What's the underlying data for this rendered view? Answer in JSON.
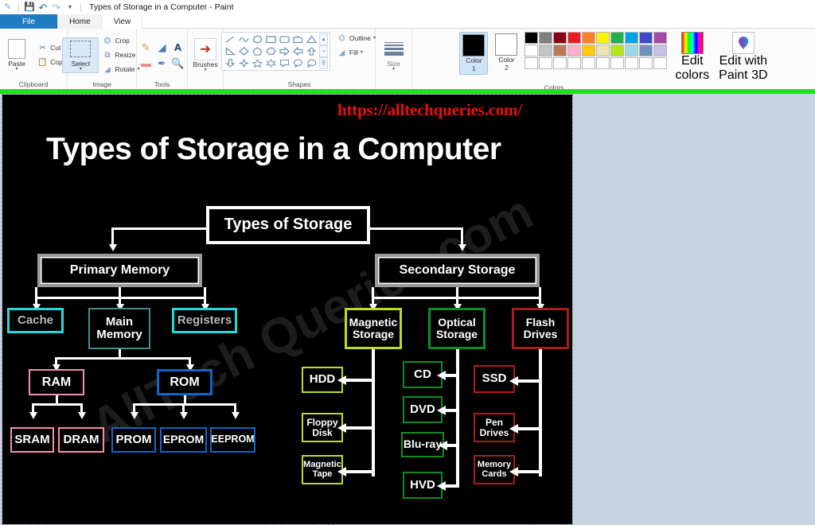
{
  "window": {
    "title": "Types of Storage in a Computer - Paint",
    "quick_access": [
      "paint-icon",
      "save-icon",
      "undo-icon",
      "redo-icon",
      "customize-icon"
    ]
  },
  "tabs": [
    {
      "label": "File",
      "state": "file"
    },
    {
      "label": "Home",
      "state": "active"
    },
    {
      "label": "View",
      "state": "normal"
    }
  ],
  "ribbon": {
    "groups": [
      {
        "name": "Clipboard",
        "label": "Clipboard",
        "big": {
          "label": "Paste",
          "icon": "paste-icon",
          "caret": "▾"
        },
        "small": [
          {
            "label": "Cut",
            "icon": "scissors-icon",
            "glyph": "✂"
          },
          {
            "label": "Copy",
            "icon": "copy-icon",
            "glyph": "❐"
          }
        ]
      },
      {
        "name": "Image",
        "label": "Image",
        "big": {
          "label": "Select",
          "icon": "select-icon",
          "caret": "▾"
        },
        "small": [
          {
            "label": "Crop",
            "icon": "crop-icon",
            "glyph": "⌧"
          },
          {
            "label": "Resize",
            "icon": "resize-icon",
            "glyph": "⧉"
          },
          {
            "label": "Rotate",
            "icon": "rotate-icon",
            "glyph": "◢",
            "caret": "▾"
          }
        ]
      },
      {
        "name": "Tools",
        "label": "Tools",
        "tools": [
          {
            "icon": "pencil-icon",
            "glyph": "✎"
          },
          {
            "icon": "fill-bucket-icon",
            "glyph": "◤"
          },
          {
            "icon": "text-icon",
            "glyph": "A"
          },
          {
            "icon": "eraser-icon",
            "glyph": "▬"
          },
          {
            "icon": "color-picker-icon",
            "glyph": "✒"
          },
          {
            "icon": "magnifier-icon",
            "glyph": "⚲"
          }
        ]
      },
      {
        "name": "Brushes",
        "label": "",
        "big": {
          "label": "Brushes",
          "icon": "brush-icon",
          "caret": "▾"
        }
      },
      {
        "name": "Shapes",
        "label": "Shapes",
        "outline": {
          "label": "Outline",
          "icon": "outline-icon",
          "caret": "▾"
        },
        "fill": {
          "label": "Fill",
          "icon": "fill-icon",
          "caret": "▾"
        },
        "scroll": [
          "▲",
          "▪",
          "☰"
        ]
      },
      {
        "name": "Size",
        "label": "",
        "big": {
          "label": "Size",
          "icon": "size-icon",
          "caret": "▾"
        }
      },
      {
        "name": "Colors",
        "label": "Colors",
        "color1": {
          "label_line1": "Color",
          "label_line2": "1",
          "value": "#000000"
        },
        "color2": {
          "label_line1": "Color",
          "label_line2": "2",
          "value": "#ffffff"
        },
        "edit_colors": {
          "label_line1": "Edit",
          "label_line2": "colors",
          "icon": "rainbow-icon"
        },
        "paint3d": {
          "label_line1": "Edit with",
          "label_line2": "Paint 3D",
          "icon": "paint3d-icon"
        },
        "palette_row1": [
          "#000000",
          "#7f7f7f",
          "#880015",
          "#ed1c24",
          "#ff7f27",
          "#fff200",
          "#22b14c",
          "#00a2e8",
          "#3f48cc",
          "#a349a4"
        ],
        "palette_row2": [
          "#ffffff",
          "#c3c3c3",
          "#b97a57",
          "#ffaec9",
          "#ffc90e",
          "#efe4b0",
          "#b5e61d",
          "#99d9ea",
          "#7092be",
          "#c8bfe7"
        ],
        "palette_row3": [
          "#ffffff",
          "#ffffff",
          "#ffffff",
          "#ffffff",
          "#ffffff",
          "#ffffff",
          "#ffffff",
          "#ffffff",
          "#ffffff",
          "#ffffff"
        ]
      }
    ]
  },
  "canvas": {
    "background": "#000000",
    "url_watermark": "https://alltechqueries.com/",
    "url_color": "#e8100f",
    "diagram_title": "Types of Storage in a Computer",
    "site_watermark": "AllTech Queries.com",
    "nodes": {
      "root": "Types of Storage",
      "primary": "Primary Memory",
      "secondary": "Secondary Storage",
      "cache": "Cache",
      "main_memory_l1": "Main",
      "main_memory_l2": "Memory",
      "registers": "Registers",
      "ram": "RAM",
      "rom": "ROM",
      "sram": "SRAM",
      "dram": "DRAM",
      "prom": "PROM",
      "eprom": "EPROM",
      "eeprom": "EEPROM",
      "magnetic_l1": "Magnetic",
      "magnetic_l2": "Storage",
      "optical_l1": "Optical",
      "optical_l2": "Storage",
      "flash_l1": "Flash",
      "flash_l2": "Drives",
      "hdd": "HDD",
      "floppy_l1": "Floppy",
      "floppy_l2": "Disk",
      "magtape_l1": "Magnetic",
      "magtape_l2": "Tape",
      "cd": "CD",
      "dvd": "DVD",
      "bluray": "Blu-ray",
      "hvd": "HVD",
      "ssd": "SSD",
      "pen_l1": "Pen",
      "pen_l2": "Drives",
      "memcard_l1": "Memory",
      "memcard_l2": "Cards"
    },
    "colors": {
      "white": "#ffffff",
      "gray_frame": "#9a9a9a",
      "cyan": "#28d7d7",
      "teal": "#3f8f8f",
      "pink": "#f48fb1",
      "blue": "#1565c0",
      "yellow_green": "#bddd22",
      "green": "#0e8c23",
      "dark_red": "#a81c20",
      "selection_bar": "#22dd22"
    }
  }
}
